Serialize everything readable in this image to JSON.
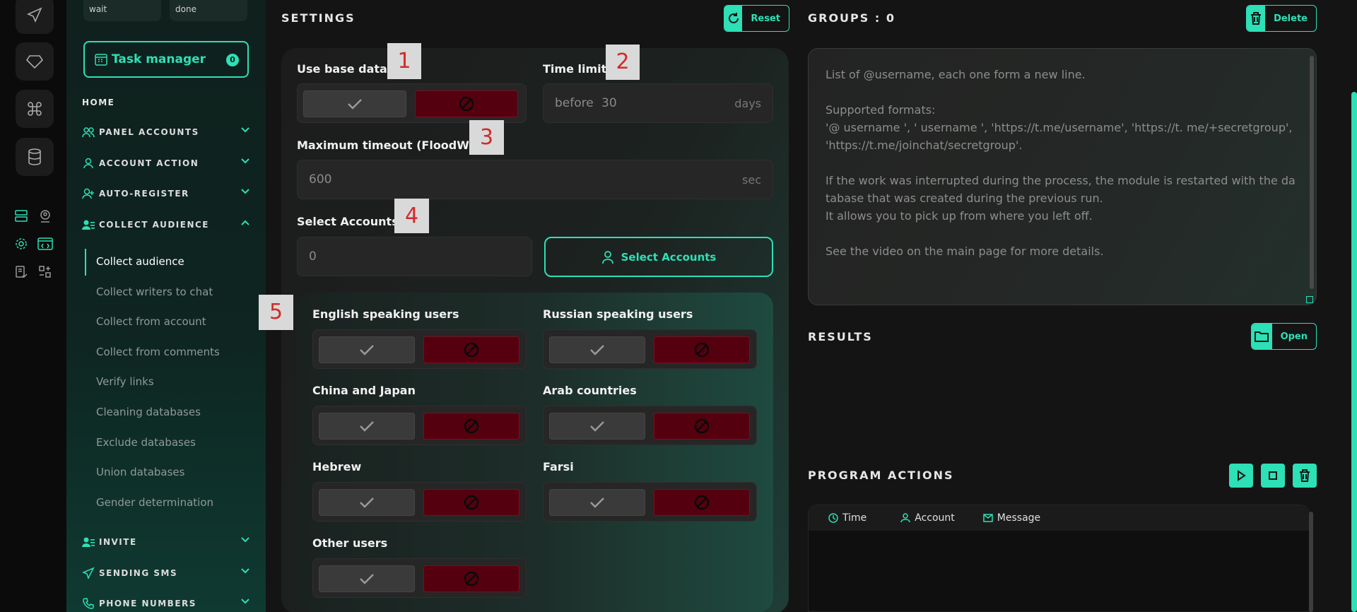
{
  "colors": {
    "accent": "#2de0b6",
    "danger": "#55000f",
    "bg": "#141414"
  },
  "sidebar": {
    "pills": [
      "wait",
      "done"
    ],
    "task_manager": {
      "label": "Task manager",
      "count": "0"
    },
    "home": "HOME",
    "sections": [
      {
        "label": "PANEL ACCOUNTS",
        "icon": "users-icon",
        "expanded": false
      },
      {
        "label": "ACCOUNT ACTION",
        "icon": "user-icon",
        "expanded": false
      },
      {
        "label": "AUTO-REGISTER",
        "icon": "user-plus-icon",
        "expanded": false
      },
      {
        "label": "COLLECT AUDIENCE",
        "icon": "user-list-icon",
        "expanded": true
      },
      {
        "label": "INVITE",
        "icon": "user-list-icon",
        "expanded": false
      },
      {
        "label": "SENDING SMS",
        "icon": "send-icon",
        "expanded": false
      },
      {
        "label": "PHONE NUMBERS",
        "icon": "phone-icon",
        "expanded": false
      }
    ],
    "collect_items": [
      "Collect audience",
      "Collect writers to chat",
      "Collect from account",
      "Collect from comments",
      "Verify links",
      "Cleaning databases",
      "Exclude databases",
      "Union databases",
      "Gender determination"
    ],
    "active_item": "Collect audience"
  },
  "settings": {
    "title": "SETTINGS",
    "reset_label": "Reset",
    "use_base_data_label": "Use base data",
    "time_limit": {
      "label": "Time limit",
      "prefix": "before",
      "value": "30",
      "suffix": "days"
    },
    "max_timeout": {
      "label": "Maximum timeout (FloodWait)",
      "value": "600",
      "suffix": "sec"
    },
    "select_accounts": {
      "label": "Select Accounts",
      "value": "0",
      "button": "Select Accounts"
    },
    "languages": [
      "English speaking users",
      "Russian speaking users",
      "China and Japan",
      "Arab countries",
      "Hebrew",
      "Farsi",
      "Other users"
    ]
  },
  "markers": [
    "1",
    "2",
    "3",
    "4",
    "5"
  ],
  "groups": {
    "title": "GROUPS : 0",
    "delete_label": "Delete",
    "placeholder_lines": [
      "List of @username, each one form a new line.",
      "",
      "Supported formats:",
      "'@ username ', ' username ', 'https://t.me/username', 'https://t. me/+secretgroup', 'https://t.me/joinchat/secretgroup'.",
      "",
      "If the work was interrupted during the process, the module is restarted with the database that was created during the previous run.",
      "It allows you to pick up from where you left off.",
      "",
      "See the video on the main page for more details."
    ]
  },
  "results": {
    "title": "RESULTS",
    "open_label": "Open"
  },
  "program_actions": {
    "title": "PROGRAM ACTIONS",
    "columns": [
      "Time",
      "Account",
      "Message"
    ]
  }
}
